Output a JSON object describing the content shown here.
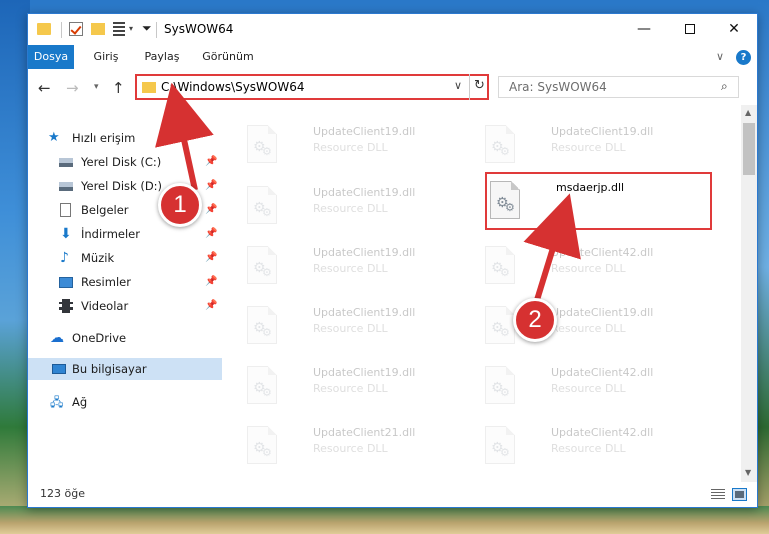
{
  "window": {
    "title": "SysWOW64",
    "minimize_glyph": "—",
    "close_glyph": "✕"
  },
  "ribbon": {
    "tabs": [
      "Dosya",
      "Giriş",
      "Paylaş",
      "Görünüm"
    ],
    "help": "?"
  },
  "address": {
    "path": "C:\\Windows\\SysWOW64",
    "search_placeholder": "Ara: SysWOW64"
  },
  "nav_pane": {
    "quick_access": "Hızlı erişim",
    "items": [
      {
        "label": "Yerel Disk (C:)",
        "icon": "drive-icon",
        "pinned": true
      },
      {
        "label": "Yerel Disk (D:)",
        "icon": "drive-icon",
        "pinned": true
      },
      {
        "label": "Belgeler",
        "icon": "documents-icon",
        "pinned": true
      },
      {
        "label": "İndirmeler",
        "icon": "downloads-icon",
        "pinned": true
      },
      {
        "label": "Müzik",
        "icon": "music-icon",
        "pinned": true
      },
      {
        "label": "Resimler",
        "icon": "pictures-icon",
        "pinned": true
      },
      {
        "label": "Videolar",
        "icon": "videos-icon",
        "pinned": true
      }
    ],
    "onedrive": "OneDrive",
    "this_pc": "Bu bilgisayar",
    "network": "Ağ"
  },
  "files": [
    {
      "name": "UpdateClient19.dll",
      "desc": "Resource DLL",
      "faded": true
    },
    {
      "name": "UpdateClient19.dll",
      "desc": "Resource DLL",
      "faded": true
    },
    {
      "name": "UpdateClient19.dll",
      "desc": "Resource DLL",
      "faded": true
    },
    {
      "name": "msdaerjp.dll",
      "desc": "",
      "faded": false
    },
    {
      "name": "UpdateClient19.dll",
      "desc": "Resource DLL",
      "faded": true
    },
    {
      "name": "UpdateClient42.dll",
      "desc": "Resource DLL",
      "faded": true
    },
    {
      "name": "UpdateClient19.dll",
      "desc": "Resource DLL",
      "faded": true
    },
    {
      "name": "UpdateClient19.dll",
      "desc": "Resource DLL",
      "faded": true
    },
    {
      "name": "UpdateClient19.dll",
      "desc": "Resource DLL",
      "faded": true
    },
    {
      "name": "UpdateClient42.dll",
      "desc": "Resource DLL",
      "faded": true
    },
    {
      "name": "UpdateClient21.dll",
      "desc": "Resource DLL",
      "faded": true
    },
    {
      "name": "UpdateClient42.dll",
      "desc": "Resource DLL",
      "faded": true
    }
  ],
  "status": {
    "item_count": "123 öğe"
  },
  "annotations": {
    "step1": "1",
    "step2": "2",
    "color": "#d63131"
  },
  "colors": {
    "accent": "#1979ca",
    "highlight_border": "#e03a3a"
  }
}
